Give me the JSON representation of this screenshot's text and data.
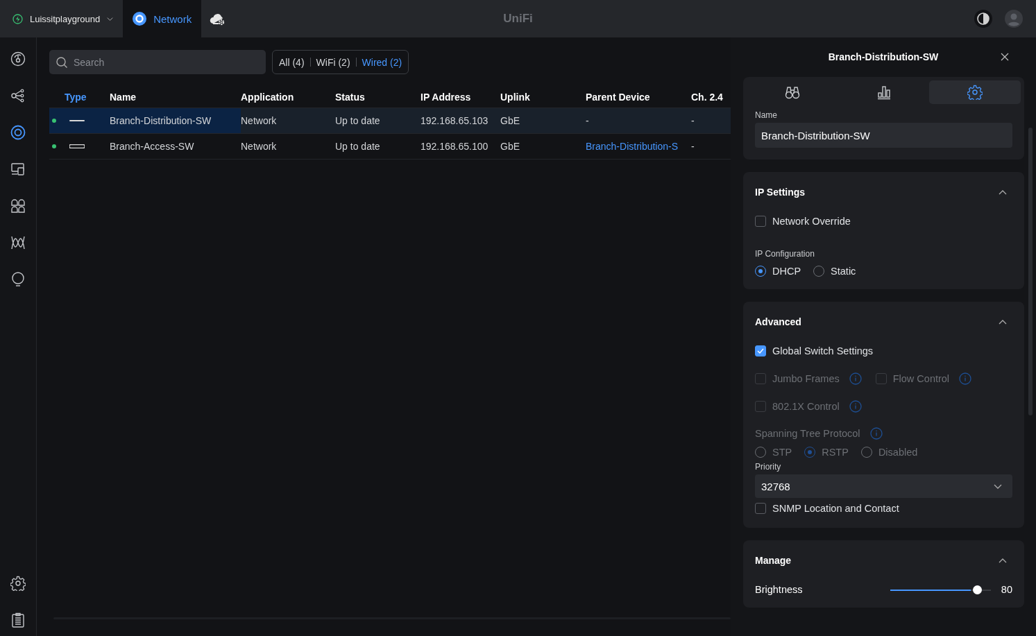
{
  "topbar": {
    "site": {
      "name": "Luissitplayground"
    },
    "app_tab": {
      "label": "Network",
      "selected": true
    },
    "logo": "UniFi"
  },
  "sidebar": {
    "items": [
      {
        "selected": false
      },
      {
        "selected": false
      },
      {
        "selected": true
      },
      {
        "selected": false
      },
      {
        "selected": false
      },
      {
        "selected": false
      },
      {
        "selected": false
      }
    ],
    "bottom_items": [
      {
        "selected": false
      },
      {
        "selected": false
      }
    ]
  },
  "search": {
    "placeholder": "Search"
  },
  "filters": [
    {
      "label": "All (4)",
      "selected": false
    },
    {
      "label": "WiFi (2)",
      "selected": false
    },
    {
      "label": "Wired (2)",
      "selected": true
    }
  ],
  "table": {
    "columns": [
      {
        "label": "Type",
        "sorted": true
      },
      {
        "label": "Name",
        "sorted": false
      },
      {
        "label": "Application",
        "sorted": false
      },
      {
        "label": "Status",
        "sorted": false
      },
      {
        "label": "IP Address",
        "sorted": false
      },
      {
        "label": "Uplink",
        "sorted": false
      },
      {
        "label": "Parent Device",
        "sorted": false
      },
      {
        "label": "Ch. 2.4",
        "sorted": false
      }
    ],
    "rows": [
      {
        "selected": true,
        "online": true,
        "kind": "slim",
        "name": "Branch-Distribution-SW",
        "application": "Network",
        "status": "Up to date",
        "ip": "192.168.65.103",
        "uplink": "GbE",
        "parent": {
          "text": "-",
          "link": false
        },
        "channel": "-"
      },
      {
        "selected": false,
        "online": true,
        "kind": "wide",
        "name": "Branch-Access-SW",
        "application": "Network",
        "status": "Up to date",
        "ip": "192.168.65.100",
        "uplink": "GbE",
        "parent": {
          "text": "Branch-Distribution-S",
          "link": true
        },
        "channel": "-"
      }
    ]
  },
  "panel": {
    "title": "Branch-Distribution-SW",
    "tabs": [
      {
        "selected": false
      },
      {
        "selected": false
      },
      {
        "selected": true
      }
    ],
    "name_field": {
      "label": "Name",
      "value": "Branch-Distribution-SW"
    },
    "sections": [
      {
        "title": "IP Settings",
        "expanded": true,
        "items": [
          {
            "kind": "checkboxes",
            "options": [
              {
                "label": "Network Override",
                "checked": false,
                "disabled": false,
                "info": false
              }
            ]
          },
          {
            "kind": "field_label",
            "text": "IP Configuration"
          },
          {
            "kind": "radios",
            "disabled": false,
            "options": [
              {
                "label": "DHCP",
                "selected": true
              },
              {
                "label": "Static",
                "selected": false
              }
            ]
          }
        ]
      },
      {
        "title": "Advanced",
        "expanded": true,
        "items": [
          {
            "kind": "checkboxes",
            "options": [
              {
                "label": "Global Switch Settings",
                "checked": true,
                "disabled": false,
                "info": false
              }
            ]
          },
          {
            "kind": "checkboxes",
            "options": [
              {
                "label": "Jumbo Frames",
                "checked": false,
                "disabled": true,
                "info": true
              },
              {
                "label": "Flow Control",
                "checked": false,
                "disabled": true,
                "info": true
              }
            ]
          },
          {
            "kind": "checkboxes",
            "options": [
              {
                "label": "802.1X Control",
                "checked": false,
                "disabled": true,
                "info": true
              }
            ]
          },
          {
            "kind": "group_label",
            "text": "Spanning Tree Protocol",
            "disabled": true,
            "info": true
          },
          {
            "kind": "radios",
            "disabled": true,
            "options": [
              {
                "label": "STP",
                "selected": false
              },
              {
                "label": "RSTP",
                "selected": true
              },
              {
                "label": "Disabled",
                "selected": false
              }
            ]
          },
          {
            "kind": "field_label",
            "text": "Priority"
          },
          {
            "kind": "select",
            "value": "32768"
          },
          {
            "kind": "checkboxes",
            "options": [
              {
                "label": "SNMP Location and Contact",
                "checked": false,
                "disabled": false,
                "info": false
              }
            ]
          }
        ]
      },
      {
        "title": "Manage",
        "expanded": true,
        "items": [
          {
            "kind": "slider",
            "label": "Brightness",
            "level": 0.8,
            "reading": "80"
          }
        ]
      }
    ]
  }
}
